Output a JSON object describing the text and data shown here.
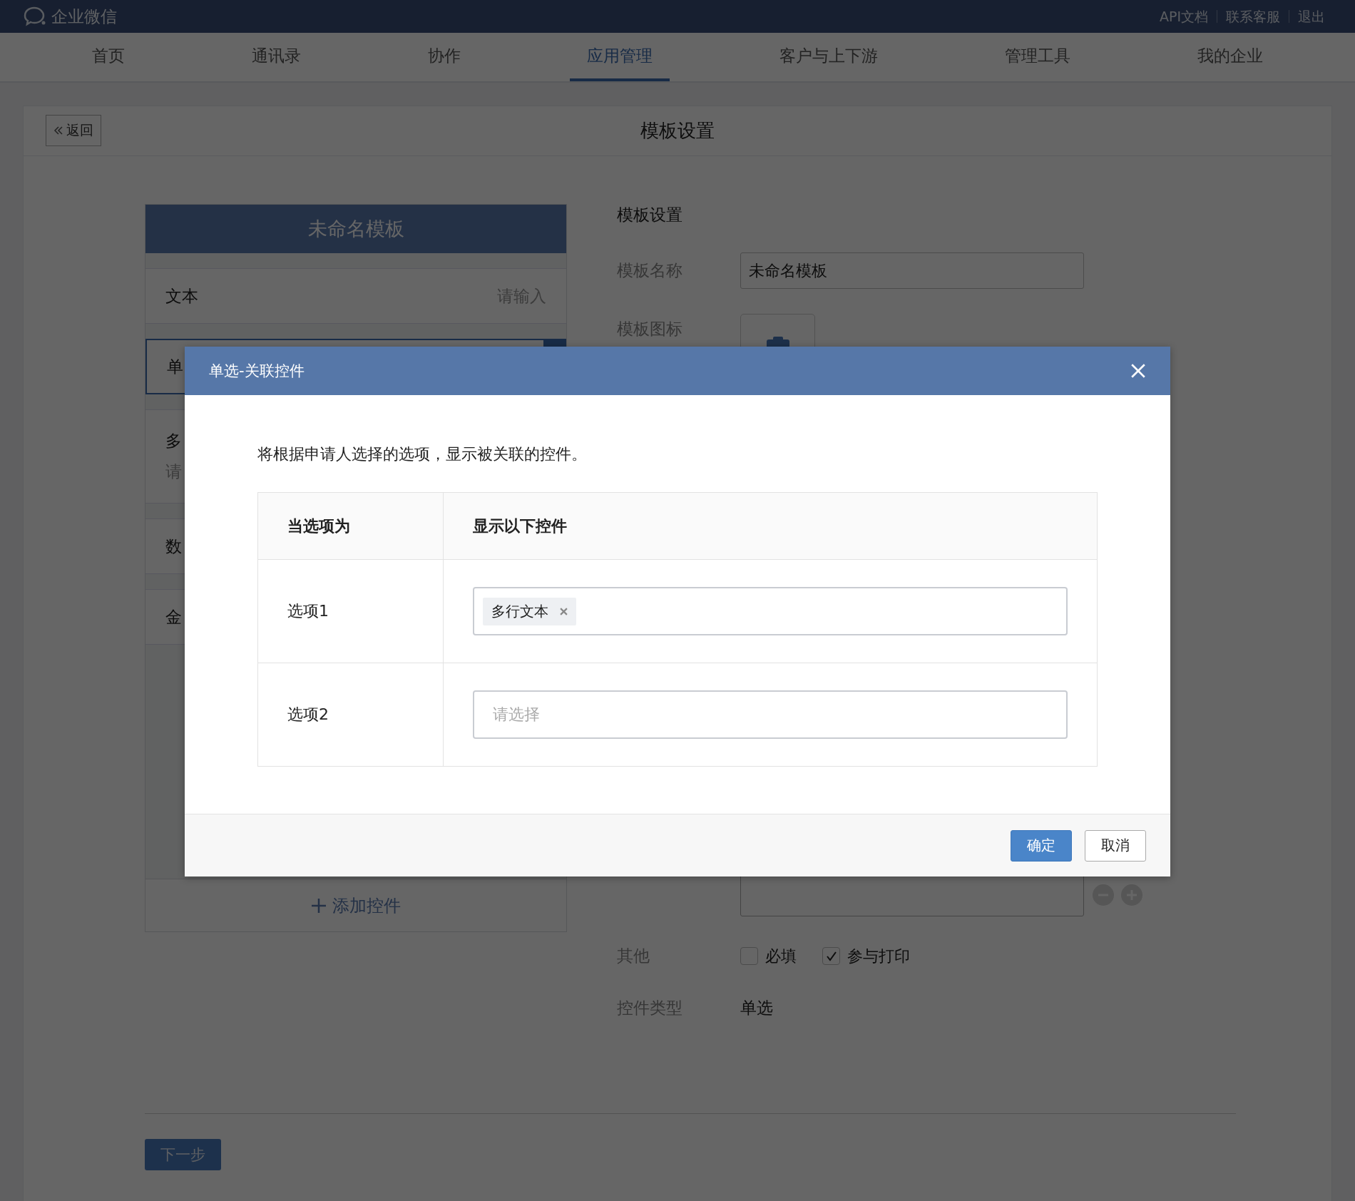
{
  "top_bar": {
    "logo_text": "企业微信",
    "links": [
      "API文档",
      "联系客服",
      "退出"
    ]
  },
  "nav": [
    {
      "label": "首页",
      "selected": false
    },
    {
      "label": "通讯录",
      "selected": false
    },
    {
      "label": "协作",
      "selected": false
    },
    {
      "label": "应用管理",
      "selected": true
    },
    {
      "label": "客户与上下游",
      "selected": false
    },
    {
      "label": "管理工具",
      "selected": false
    },
    {
      "label": "我的企业",
      "selected": false
    }
  ],
  "page": {
    "back_button": "返回",
    "title": "模板设置"
  },
  "template_preview": {
    "title": "未命名模板",
    "items": [
      {
        "kind": "row",
        "label": "文本",
        "hint": "请输入",
        "selected": false
      },
      {
        "kind": "row",
        "label": "单",
        "selected": true
      },
      {
        "kind": "stacked",
        "label": "多",
        "hint": "请",
        "selected": false
      },
      {
        "kind": "row",
        "label": "数",
        "selected": false
      },
      {
        "kind": "row",
        "label": "金",
        "selected": false
      }
    ],
    "add_button": "添加控件"
  },
  "settings": {
    "heading": "模板设置",
    "name_label": "模板名称",
    "name_value": "未命名模板",
    "icon_label": "模板图标",
    "other_label": "其他",
    "options": [
      {
        "label": "必填",
        "checked": false
      },
      {
        "label": "参与打印",
        "checked": true
      }
    ],
    "type_label": "控件类型",
    "type_value": "单选"
  },
  "next_button": "下一步",
  "dialog": {
    "title": "单选-关联控件",
    "description": "将根据申请人选择的选项，显示被关联的控件。",
    "columns": [
      "当选项为",
      "显示以下控件"
    ],
    "rows": [
      {
        "option": "选项1",
        "tags": [
          "多行文本"
        ]
      },
      {
        "option": "选项2",
        "placeholder": "请选择"
      }
    ],
    "buttons": [
      {
        "label": "确定",
        "kind": "primary"
      },
      {
        "label": "取消",
        "kind": "default"
      }
    ]
  }
}
